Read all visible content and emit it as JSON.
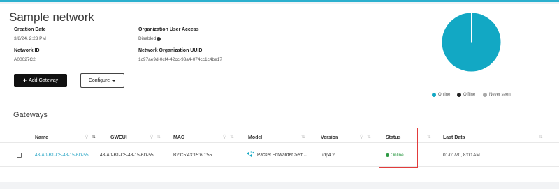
{
  "page": {
    "title": "Sample network"
  },
  "network": {
    "creation_date_label": "Creation Date",
    "creation_date_value": "3/8/24, 2:23 PM",
    "network_id_label": "Network ID",
    "network_id_value": "A00027C2",
    "org_access_label": "Organization User Access",
    "org_access_value": "Disabled",
    "org_uuid_label": "Network Organization UUID",
    "org_uuid_value": "1c97ae9d-0cf4-42cc-93a4-074cc1c4be17"
  },
  "actions": {
    "add_gateway_label": "Add Gateway",
    "configure_label": "Configure"
  },
  "status_chart": {
    "chart_data": {
      "type": "pie",
      "categories": [
        "Online",
        "Offline",
        "Never seen"
      ],
      "values": [
        1,
        0,
        0
      ],
      "colors": [
        "#12a8c4",
        "#222222",
        "#a8a8a8"
      ]
    }
  },
  "gateways": {
    "section_title": "Gateways",
    "columns": {
      "name": "Name",
      "gweui": "GWEUI",
      "mac": "MAC",
      "model": "Model",
      "version": "Version",
      "status": "Status",
      "last_data": "Last Data"
    },
    "rows": [
      {
        "name": "43-A0-B1-C5-43-15-6D-55",
        "gweui": "43-A0-B1-C5-43-15-6D-55",
        "mac": "B2:C5:43:15:6D:55",
        "model": "Packet Forwarder Sem...",
        "version": "udp4.2",
        "status": "Online",
        "last_data": "01/01/70, 8:00 AM"
      }
    ]
  },
  "colors": {
    "accent": "#2cb0ce",
    "online": "#2e9a44",
    "highlight": "#e23b3b"
  }
}
